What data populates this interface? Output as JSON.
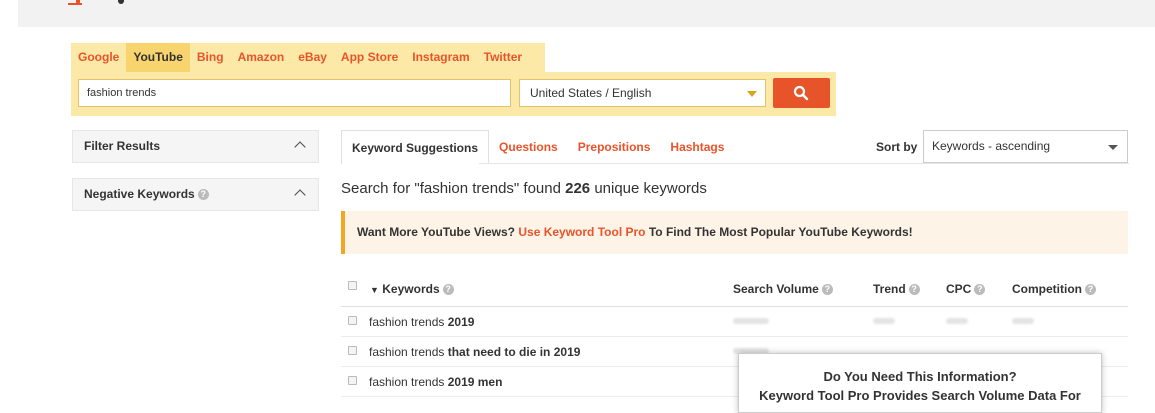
{
  "search_tabs": [
    "Google",
    "YouTube",
    "Bing",
    "Amazon",
    "eBay",
    "App Store",
    "Instagram",
    "Twitter"
  ],
  "active_search_tab": "YouTube",
  "query": {
    "value": "fashion trends"
  },
  "location": {
    "value": "United States / English"
  },
  "sidebar": {
    "filter_results": "Filter Results",
    "negative_keywords": "Negative Keywords"
  },
  "result_tabs": [
    "Keyword Suggestions",
    "Questions",
    "Prepositions",
    "Hashtags"
  ],
  "sort": {
    "label": "Sort by",
    "value": "Keywords - ascending"
  },
  "found": {
    "prefix": "Search for \"fashion trends\" found ",
    "count": "226",
    "suffix": " unique keywords"
  },
  "promo": {
    "before": "Want More YouTube Views? ",
    "link": "Use Keyword Tool Pro",
    "after": " To Find The Most Popular YouTube Keywords!"
  },
  "table": {
    "headers": {
      "keywords": "Keywords",
      "search_volume": "Search Volume",
      "trend": "Trend",
      "cpc": "CPC",
      "competition": "Competition"
    },
    "rows": [
      {
        "base": "fashion trends ",
        "extra": "2019"
      },
      {
        "base": "fashion trends ",
        "extra": "that need to die in 2019"
      },
      {
        "base": "fashion trends ",
        "extra": "2019 men"
      }
    ]
  },
  "popup": {
    "title": "Do You Need This Information?",
    "line2": "Keyword Tool Pro Provides Search Volume Data For"
  },
  "colors": {
    "accent": "#e8542a",
    "panel": "#fce9a8",
    "active_tab": "#f7d46e"
  }
}
